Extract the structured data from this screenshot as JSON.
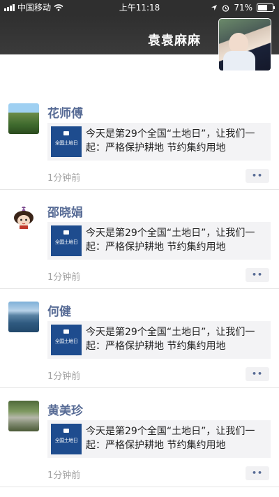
{
  "status_bar": {
    "carrier": "中国移动",
    "time": "上午11:18",
    "battery_text": "71%",
    "battery_level": 0.71
  },
  "cover": {
    "owner_name": "袁袁麻麻"
  },
  "posts": [
    {
      "name": "花师傅",
      "link": {
        "thumb_text": "全国土地日",
        "title": "今天是第29个全国“土地日”，让我们一起：严格保护耕地 节约集约用地"
      },
      "time": "1分钟前",
      "more": "••"
    },
    {
      "name": "邵晓娟",
      "link": {
        "thumb_text": "全国土地日",
        "title": "今天是第29个全国“土地日”，让我们一起：严格保护耕地 节约集约用地"
      },
      "time": "1分钟前",
      "more": "••"
    },
    {
      "name": "何健",
      "link": {
        "thumb_text": "全国土地日",
        "title": "今天是第29个全国“土地日”，让我们一起：严格保护耕地 节约集约用地"
      },
      "time": "1分钟前",
      "more": "••"
    },
    {
      "name": "黄美珍",
      "link": {
        "thumb_text": "全国土地日",
        "title": "今天是第29个全国“土地日”，让我们一起：严格保护耕地 节约集约用地"
      },
      "time": "1分钟前",
      "more": "••"
    }
  ]
}
